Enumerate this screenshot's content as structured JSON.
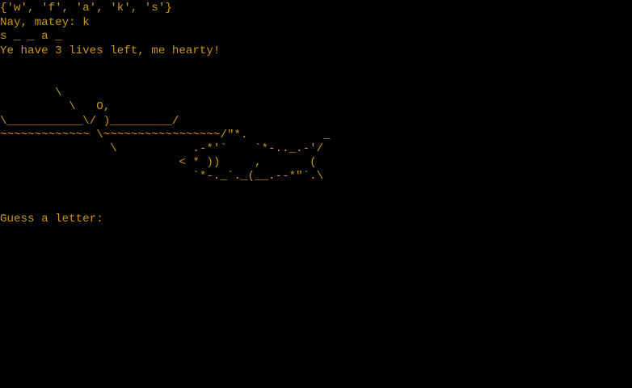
{
  "terminal": {
    "guessed_set": "{'w', 'f', 'a', 'k', 's'}",
    "feedback": "Nay, matey: k",
    "word_progress": "s _ _ a _",
    "lives_message": "Ye have 3 lives left, me hearty!",
    "ascii_art": "\n\n        \\\n          \\   O,\n\\___________\\/ )_________/\n~~~~~~~~~~~~~ \\~~~~~~~~~~~~~~~~~/\"*.           _\n                \\           .-*'`    `*-.._.-'/\n                          < * ))     ,       (\n                            `*-._`._(__.--*\"`.\\",
    "prompt": "Guess a letter:",
    "input_value": ""
  },
  "colors": {
    "background": "#000000",
    "text": "#c8961e",
    "cursor": "#f0f0f0"
  }
}
